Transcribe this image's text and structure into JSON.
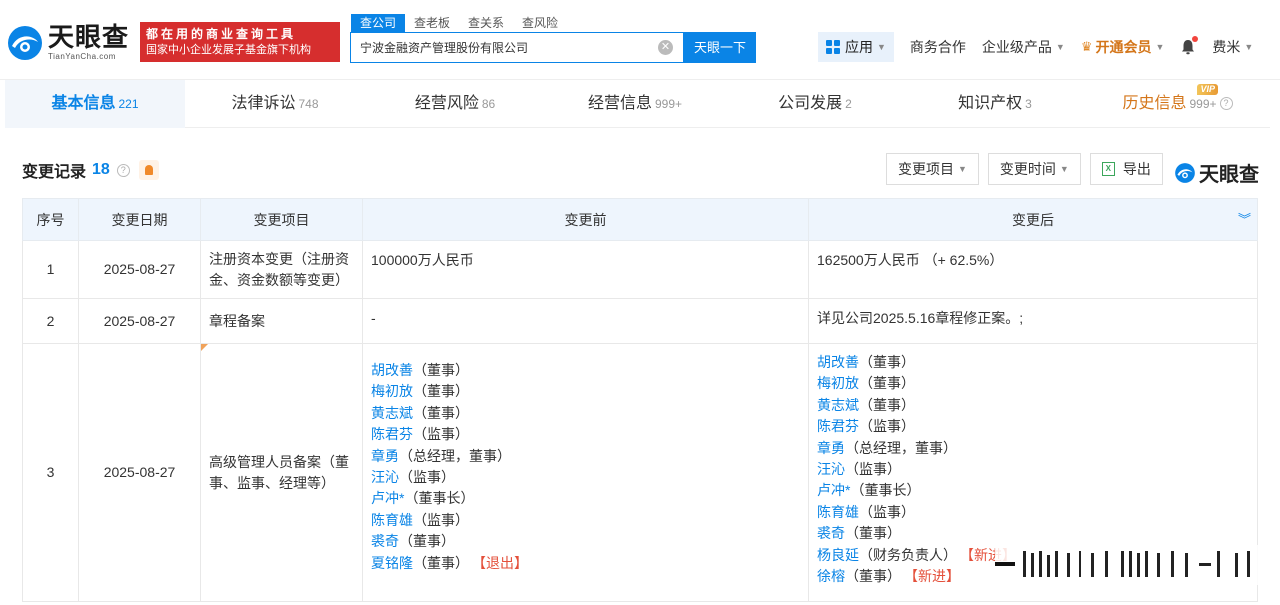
{
  "brand": {
    "name_cn": "天眼查",
    "name_en": "TianYanCha.com",
    "slogan_line1": "都在用的商业查询工具",
    "slogan_line2": "国家中小企业发展子基金旗下机构"
  },
  "search": {
    "tabs": [
      "查公司",
      "查老板",
      "查关系",
      "查风险"
    ],
    "value": "宁波金融资产管理股份有限公司",
    "button": "天眼一下"
  },
  "nav": {
    "apps": "应用",
    "business": "商务合作",
    "enterprise": "企业级产品",
    "vip": "开通会员",
    "user": "费米"
  },
  "tabs": [
    {
      "label": "基本信息",
      "count": "221"
    },
    {
      "label": "法律诉讼",
      "count": "748"
    },
    {
      "label": "经营风险",
      "count": "86"
    },
    {
      "label": "经营信息",
      "count": "999+"
    },
    {
      "label": "公司发展",
      "count": "2"
    },
    {
      "label": "知识产权",
      "count": "3"
    },
    {
      "label": "历史信息",
      "count": "999+",
      "tag": "VIP"
    }
  ],
  "section": {
    "title": "变更记录",
    "count": "18",
    "filter_item": "变更项目",
    "filter_time": "变更时间",
    "export": "导出",
    "brand": "天眼查"
  },
  "table": {
    "headers": [
      "序号",
      "变更日期",
      "变更项目",
      "变更前",
      "变更后"
    ],
    "rows": [
      {
        "no": "1",
        "date": "2025-08-27",
        "item": "注册资本变更（注册资金、资金数额等变更）",
        "before": "100000万人民币",
        "after": "162500万人民币 （+ 62.5%）"
      },
      {
        "no": "2",
        "date": "2025-08-27",
        "item": "章程备案",
        "before": "-",
        "after": "详见公司2025.5.16章程修正案。;"
      },
      {
        "no": "3",
        "date": "2025-08-27",
        "item": "高级管理人员备案（董事、监事、经理等）",
        "before_people": [
          {
            "name": "胡改善",
            "role": "（董事）"
          },
          {
            "name": "梅初放",
            "role": "（董事）"
          },
          {
            "name": "黄志斌",
            "role": "（董事）"
          },
          {
            "name": "陈君芬",
            "role": "（监事）"
          },
          {
            "name": "章勇",
            "role": "（总经理，董事）"
          },
          {
            "name": "汪沁",
            "role": "（监事）"
          },
          {
            "name": "卢冲*",
            "role": "（董事长）"
          },
          {
            "name": "陈育雄",
            "role": "（监事）"
          },
          {
            "name": "裘奇",
            "role": "（董事）"
          },
          {
            "name": "夏铭隆",
            "role": "（董事）",
            "tag": "【退出】"
          }
        ],
        "after_people": [
          {
            "name": "胡改善",
            "role": "（董事）"
          },
          {
            "name": "梅初放",
            "role": "（董事）"
          },
          {
            "name": "黄志斌",
            "role": "（董事）"
          },
          {
            "name": "陈君芬",
            "role": "（监事）"
          },
          {
            "name": "章勇",
            "role": "（总经理，董事）"
          },
          {
            "name": "汪沁",
            "role": "（监事）"
          },
          {
            "name": "卢冲*",
            "role": "（董事长）"
          },
          {
            "name": "陈育雄",
            "role": "（监事）"
          },
          {
            "name": "裘奇",
            "role": "（董事）"
          },
          {
            "name": "杨良延",
            "role": "（财务负责人）",
            "tag": "【新进】"
          },
          {
            "name": "徐榕",
            "role": "（董事）",
            "tag": "【新进】"
          }
        ]
      }
    ]
  },
  "colors": {
    "primary": "#0a84e6",
    "danger": "#e4503b",
    "vip": "#d4761a",
    "slogan_bg": "#d62e2e"
  }
}
